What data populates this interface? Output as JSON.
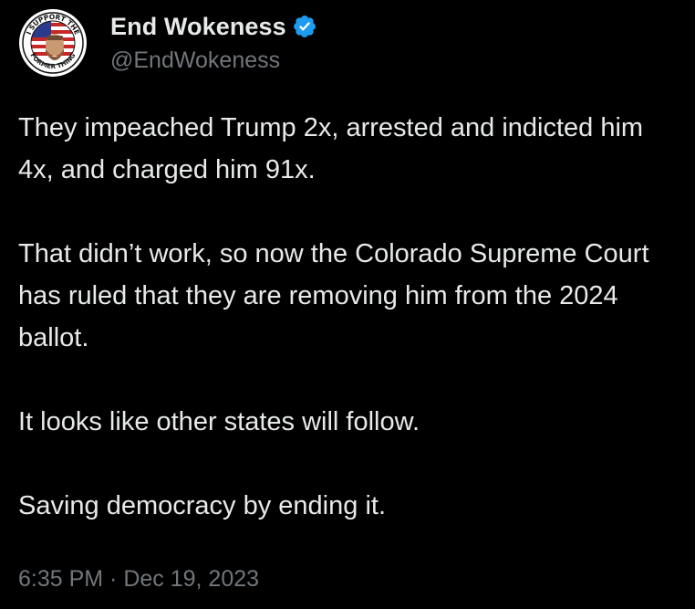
{
  "author": {
    "display_name": "End Wokeness",
    "handle": "@EndWokeness",
    "verified_icon": "verified-badge-icon",
    "avatar": {
      "top_text": "I SUPPORT THE",
      "bottom_text": "FORMER THING",
      "description": "circular badge logo with flag and bearded face"
    }
  },
  "tweet": {
    "paragraphs": [
      "They impeached Trump 2x, arrested and indicted him 4x, and charged him 91x.",
      "That didn’t work, so now the Colorado Supreme Court has ruled that they are removing him from the 2024 ballot.",
      "It looks like other states will follow.",
      "Saving democracy by ending it."
    ],
    "timestamp": "6:35 PM · Dec 19, 2023"
  },
  "colors": {
    "background": "#000000",
    "primary_text": "#e7e9ea",
    "secondary_text": "#71767b",
    "verified_blue": "#1d9bf0"
  }
}
